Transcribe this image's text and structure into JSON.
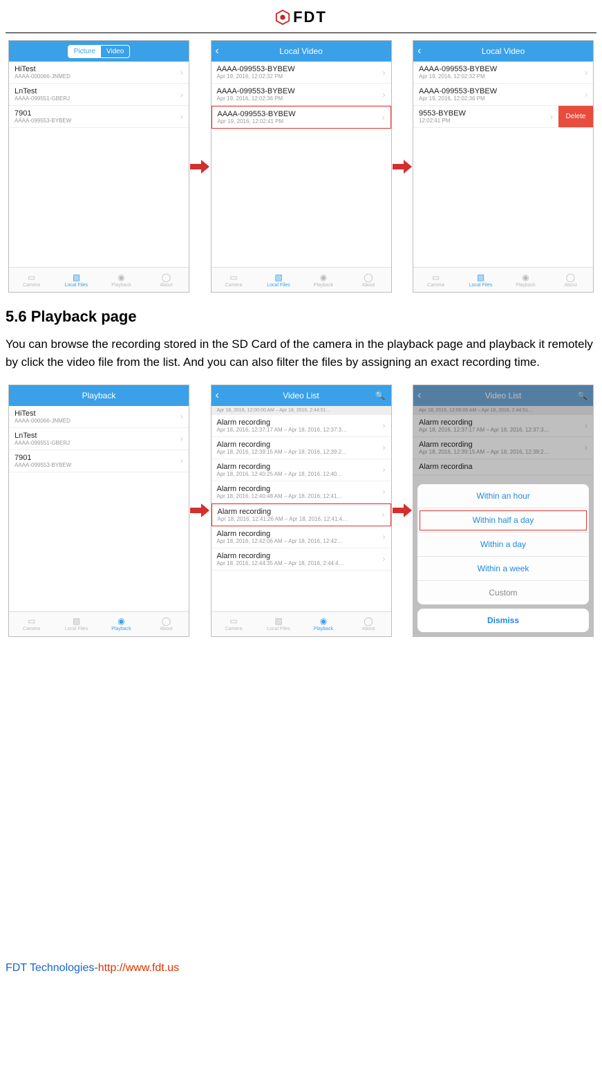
{
  "header": {
    "brand": "FDT"
  },
  "row1": {
    "screen1": {
      "toggle": {
        "left": "Picture",
        "right": "Video"
      },
      "items": [
        {
          "title": "HiTest",
          "sub": "AAAA-000066-JNMED"
        },
        {
          "title": "LnTest",
          "sub": "AAAA-099551-GBERJ"
        },
        {
          "title": "7901",
          "sub": "AAAA-099553-BYBEW"
        }
      ]
    },
    "screen2": {
      "title": "Local Video",
      "items": [
        {
          "title": "AAAA-099553-BYBEW",
          "sub": "Apr 19, 2016, 12:02:32 PM"
        },
        {
          "title": "AAAA-099553-BYBEW",
          "sub": "Apr 19, 2016, 12:02:36 PM"
        },
        {
          "title": "AAAA-099553-BYBEW",
          "sub": "Apr 19, 2016, 12:02:41 PM"
        }
      ]
    },
    "screen3": {
      "title": "Local Video",
      "items": [
        {
          "title": "AAAA-099553-BYBEW",
          "sub": "Apr 19, 2016, 12:02:32 PM"
        },
        {
          "title": "AAAA-099553-BYBEW",
          "sub": "Apr 19, 2016, 12:02:36 PM"
        },
        {
          "title": "9553-BYBEW",
          "sub": "12:02:41 PM"
        }
      ],
      "delete_label": "Delete"
    },
    "tabs": {
      "camera": "Camera",
      "local": "Local Files",
      "playback": "Playback",
      "about": "About"
    }
  },
  "section": {
    "heading": "5.6 Playback page",
    "body": "You can browse the recording stored in the SD Card of the camera in the playback page and playback it remotely by click the video file from the list. And you can also filter the files by assigning an exact recording time."
  },
  "row2": {
    "screen1": {
      "title": "Playback",
      "items": [
        {
          "title": "HiTest",
          "sub": "AAAA-000066-JNMED"
        },
        {
          "title": "LnTest",
          "sub": "AAAA-099551-GBERJ"
        },
        {
          "title": "7901",
          "sub": "AAAA-099553-BYBEW"
        }
      ]
    },
    "screen2": {
      "title": "Video List",
      "strip": "Apr 18, 2016, 12:00:00 AM – Apr 18, 2016, 2:44:51…",
      "items": [
        {
          "title": "Alarm recording",
          "sub": "Apr 18, 2016, 12:37:17 AM – Apr 18, 2016, 12:37:3…"
        },
        {
          "title": "Alarm recording",
          "sub": "Apr 18, 2016, 12:39:15 AM – Apr 18, 2016, 12:39:2…"
        },
        {
          "title": "Alarm recording",
          "sub": "Apr 18, 2016, 12:40:25 AM – Apr 18, 2016, 12:40…"
        },
        {
          "title": "Alarm recording",
          "sub": "Apr 18, 2016, 12:40:48 AM – Apr 18, 2016, 12:41…"
        },
        {
          "title": "Alarm recording",
          "sub": "Apr 18, 2016, 12:41:26 AM – Apr 18, 2016, 12:41:4…"
        },
        {
          "title": "Alarm recording",
          "sub": "Apr 18, 2016, 12:42:06 AM – Apr 18, 2016, 12:42…"
        },
        {
          "title": "Alarm recording",
          "sub": "Apr 18, 2016, 12:44:35 AM – Apr 18, 2016, 2:44:4…"
        }
      ]
    },
    "screen3": {
      "title": "Video List",
      "strip": "Apr 18, 2016, 12:00:00 AM – Apr 18, 2016, 2:44:51…",
      "items": [
        {
          "title": "Alarm recording",
          "sub": "Apr 18, 2016, 12:37:17 AM – Apr 18, 2016, 12:37:3…"
        },
        {
          "title": "Alarm recording",
          "sub": "Apr 18, 2016, 12:39:15 AM – Apr 18, 2016, 12:39:2…"
        },
        {
          "title": "Alarm recordina",
          "sub": ""
        }
      ],
      "sheet": {
        "opt1": "Within an hour",
        "opt2": "Within half a day",
        "opt3": "Within a day",
        "opt4": "Within a week",
        "opt5": "Custom",
        "dismiss": "Dismiss"
      }
    },
    "tabs": {
      "camera": "Camera",
      "local": "Local Files",
      "playback": "Playback",
      "about": "About"
    }
  },
  "footer": {
    "company": "FDT Technologies-",
    "url": "http://www.fdt.us"
  }
}
